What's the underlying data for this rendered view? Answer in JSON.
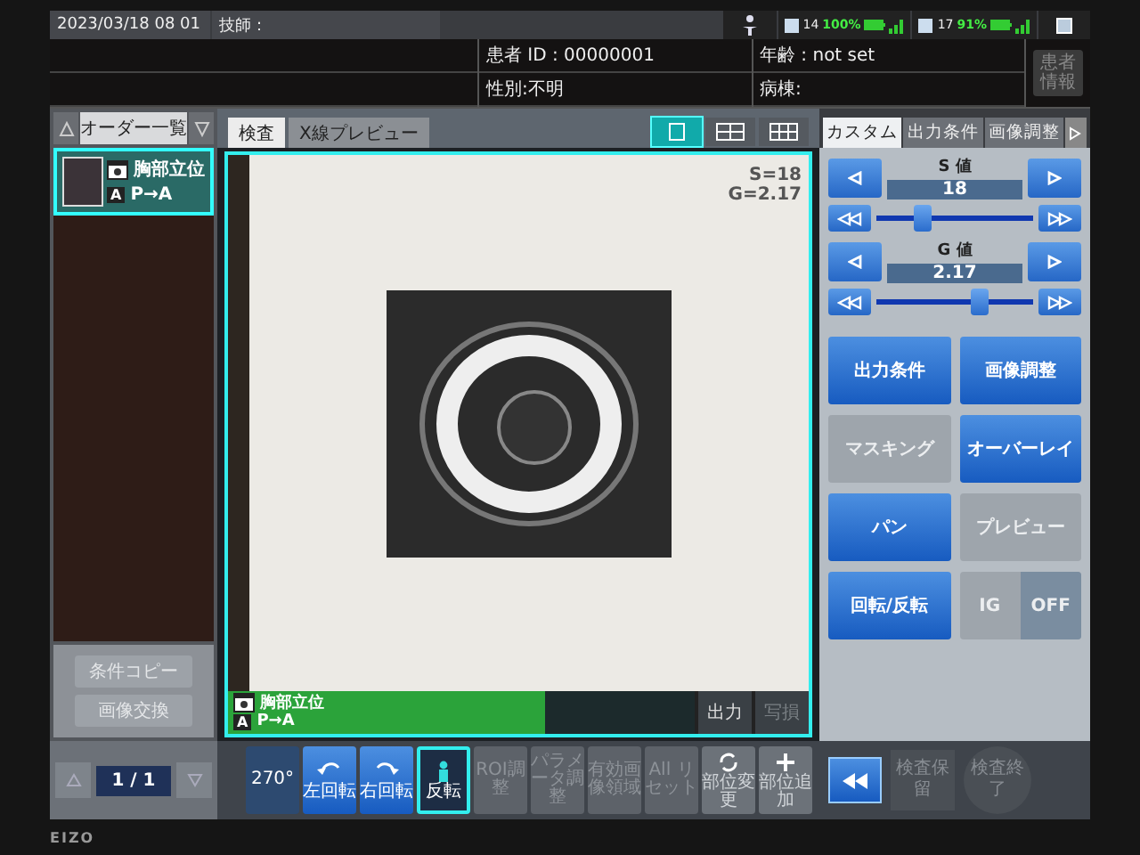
{
  "status_bar": {
    "datetime": "2023/03/18 08 01",
    "technician": "技師：",
    "indicators": [
      {
        "count": "14",
        "battery": "100%"
      },
      {
        "count": "17",
        "battery": "91%"
      }
    ]
  },
  "patient": {
    "id": "患者 ID : 00000001",
    "sex": "性別:不明",
    "age": "年齢 : not set",
    "ward": "病棟:",
    "info_button": "患者情報"
  },
  "order_list": {
    "title": "オーダー一覧",
    "exams": [
      {
        "body_part": "胸部立位",
        "marker": "A",
        "direction": "P→A",
        "selected": true
      }
    ],
    "buttons": [
      {
        "label": "条件コピー",
        "disabled": true
      },
      {
        "label": "画像交換",
        "disabled": true
      }
    ],
    "page": "1 / 1"
  },
  "viewer": {
    "tabs": [
      {
        "label": "検査",
        "selected": true
      },
      {
        "label": "X線プレビュー",
        "selected": false
      }
    ],
    "layouts": [
      {
        "kind": "single",
        "selected": true
      },
      {
        "kind": "double",
        "selected": false
      },
      {
        "kind": "quad",
        "selected": false
      }
    ],
    "overlay": [
      "S=18",
      "G=2.17"
    ],
    "info": {
      "body_part": "胸部立位",
      "marker": "A",
      "direction": "P→A",
      "level": 0.68
    },
    "buttons": [
      {
        "label": "出力",
        "disabled": false
      },
      {
        "label": "写損",
        "disabled": true
      }
    ]
  },
  "toolbar": [
    {
      "label": "270°",
      "kind": "none",
      "selected": false,
      "disabled": false
    },
    {
      "label": "左回転",
      "kind": "rotate-left",
      "selected": false,
      "disabled": false
    },
    {
      "label": "右回転",
      "kind": "rotate-right",
      "selected": false,
      "disabled": false
    },
    {
      "label": "反転",
      "kind": "flip",
      "selected": true,
      "disabled": false
    },
    {
      "label": "ROI調整",
      "kind": "none",
      "selected": false,
      "disabled": true
    },
    {
      "label": "パラメータ調整",
      "kind": "none",
      "selected": false,
      "disabled": true
    },
    {
      "label": "有効画像領域",
      "kind": "none",
      "selected": false,
      "disabled": true
    },
    {
      "label": "All リセット",
      "kind": "none",
      "selected": false,
      "disabled": true
    },
    {
      "label": "部位変更",
      "kind": "refresh",
      "selected": false,
      "disabled": false
    },
    {
      "label": "部位追加",
      "kind": "plus",
      "selected": false,
      "disabled": false
    }
  ],
  "right_panel": {
    "tabs": [
      {
        "label": "カスタム",
        "selected": true
      },
      {
        "label": "出力条件",
        "selected": false
      },
      {
        "label": "画像調整",
        "selected": false
      }
    ],
    "adjusters": [
      {
        "title": "S 値",
        "value": "18",
        "level": 0.3
      },
      {
        "title": "G 値",
        "value": "2.17",
        "level": 0.66
      }
    ],
    "buttons": [
      {
        "kind": "button",
        "label": "出力条件",
        "disabled": false
      },
      {
        "kind": "button",
        "label": "画像調整",
        "disabled": false
      },
      {
        "kind": "button",
        "label": "マスキング",
        "disabled": true
      },
      {
        "kind": "button",
        "label": "オーバーレイ",
        "disabled": false
      },
      {
        "kind": "button",
        "label": "パン",
        "disabled": false
      },
      {
        "kind": "button",
        "label": "プレビュー",
        "disabled": true
      },
      {
        "kind": "button",
        "label": "回転/反転",
        "disabled": false
      },
      {
        "kind": "toggle",
        "label": "IG",
        "state": "OFF",
        "disabled": true
      }
    ]
  },
  "footer": {
    "buttons": [
      {
        "label": "検査保留",
        "disabled": true
      },
      {
        "label": "検査終了",
        "disabled": true
      }
    ]
  },
  "monitor": {
    "brand": "EIZO"
  }
}
